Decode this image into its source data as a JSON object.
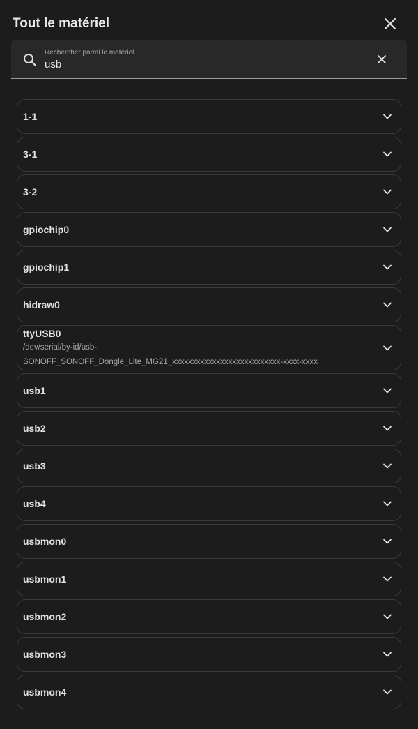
{
  "dialog": {
    "title": "Tout le matériel",
    "close_icon": "close-icon"
  },
  "search": {
    "label": "Rechercher parmi le matériel",
    "value": "usb",
    "search_icon": "search-icon",
    "clear_icon": "close-icon"
  },
  "devices": [
    {
      "name": "1-1"
    },
    {
      "name": "3-1"
    },
    {
      "name": "3-2"
    },
    {
      "name": "gpiochip0"
    },
    {
      "name": "gpiochip1"
    },
    {
      "name": "hidraw0"
    },
    {
      "name": "ttyUSB0",
      "path_line1": "/dev/serial/by-id/usb-",
      "path_line2": "SONOFF_SONOFF_Dongle_Lite_MG21_xxxxxxxxxxxxxxxxxxxxxxxxxxx-xxxx-xxxx"
    },
    {
      "name": "usb1"
    },
    {
      "name": "usb2"
    },
    {
      "name": "usb3"
    },
    {
      "name": "usb4"
    },
    {
      "name": "usbmon0"
    },
    {
      "name": "usbmon1"
    },
    {
      "name": "usbmon2"
    },
    {
      "name": "usbmon3"
    },
    {
      "name": "usbmon4"
    }
  ],
  "expand_icon": "chevron-down-icon"
}
